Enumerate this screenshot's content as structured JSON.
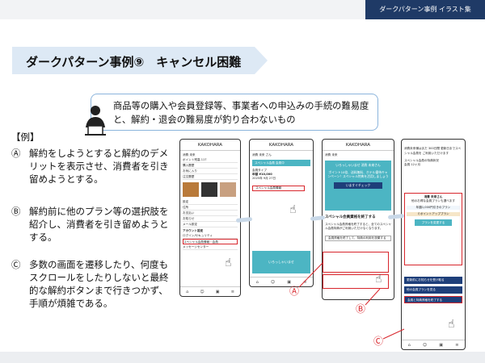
{
  "header": {
    "series_label": "ダークパターン事例 イラスト集"
  },
  "slide": {
    "title": "ダークパターン事例⑨　キャンセル困難"
  },
  "definition": {
    "text": "商品等の購入や会員登録等、事業者への申込みの手続の難易度と、解約・退会の難易度が釣り合わないもの"
  },
  "examples": {
    "heading": "【例】",
    "items": [
      {
        "mark": "Ⓐ",
        "text": "解約をしようとすると解約のデメリットを表示させ、消費者を引き留めようとする。"
      },
      {
        "mark": "Ⓑ",
        "text": "解約前に他のプラン等の選択肢を紹介し、消費者を引き留めようとする。"
      },
      {
        "mark": "Ⓒ",
        "text": "多数の画面を遷移したり、何度もスクロールをしたりしないと最終的な解約ボタンまで行きつかず、手順が煩雑である。"
      }
    ]
  },
  "phones": {
    "p1": {
      "title": "KAKOHARA",
      "user": "消費 未来",
      "rows": [
        "ポイント残高 117",
        "購入履歴",
        "お気に入り",
        "注文履歴"
      ],
      "menu": [
        "設定",
        "住所",
        "お支払い",
        "お知らせ",
        "メール設定"
      ],
      "account_title": "アカウント設定",
      "links": [
        "ログイン/セキュリティ",
        "スペシャル会員情報・会員",
        "メッセージセンター"
      ]
    },
    "p2": {
      "title": "KAKOHARA",
      "user": "消費 未来 さん",
      "banner": "スペシャル会員 会員中",
      "info1": "会員タイプ",
      "info2": "年額 ¥10,000",
      "info3": "2025年 9月 27日",
      "settings": "スペシャル会員情報",
      "promo": "いろっしゃいませ"
    },
    "p3": {
      "title": "KAKOHARA",
      "user": "消費 未来",
      "promo_head": "いろっしゃいませ 消費 未来さん",
      "promo_body": "ポイント10倍、送料無料、ホテル優待キャンペーン！スペシャル特典を活用しましょう",
      "promo_btn": "いますぐチェック",
      "warn_title": "スペシャル会員資格を終了する",
      "warn_body": "スペシャル会員資格を終了すると、全てのスペシャル会員特典がご利用いただけなくなります。",
      "warn_btn": "会員資格を終了して、特典の利用を放棄する"
    },
    "p4": {
      "head": "消費未来様はまだ 300日間 更新日までスペシャル会員を ご利用いただけます",
      "special": "スペシャル会員の特典状況",
      "months": "会員 12ヶ月",
      "card_title": "消費 未来さん",
      "card_line": "他のお得な会員プランも選べます",
      "card_price": "年額1,000円引きのプラン",
      "card_point": "ミポイントアッププラン",
      "card_btn": "プランを変更する",
      "btn1": "更新前にお知らせを受け取る",
      "btn2": "他の会員プランを見る",
      "btn3": "会員と特典資格を終了する"
    }
  },
  "callouts": {
    "a": "Ⓐ",
    "b": "Ⓑ",
    "c": "Ⓒ"
  },
  "colors": {
    "navy": "#1e3f7a",
    "teal": "#4cb5c3",
    "red": "#d8262c",
    "accent": "#dde9f5"
  }
}
